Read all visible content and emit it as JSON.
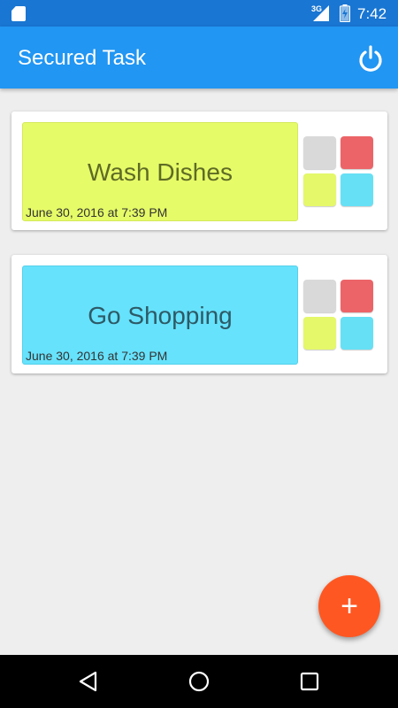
{
  "status_bar": {
    "network": "3G",
    "time": "7:42",
    "icons": [
      "sd-card-icon",
      "signal-icon",
      "battery-icon"
    ]
  },
  "app_bar": {
    "title": "Secured Task",
    "action_icon": "power-icon"
  },
  "tasks": [
    {
      "title": "Wash Dishes",
      "date": "June 30, 2016 at 7:39 PM",
      "color": "#e6fb68"
    },
    {
      "title": "Go Shopping",
      "date": "June 30, 2016 at 7:39 PM",
      "color": "#66e2fc"
    }
  ],
  "color_swatches": [
    {
      "name": "gray",
      "color": "#d9d9d9"
    },
    {
      "name": "red",
      "color": "#ec6468"
    },
    {
      "name": "lime",
      "color": "#e4f86a"
    },
    {
      "name": "cyan",
      "color": "#66e0f5"
    }
  ],
  "fab": {
    "icon": "plus-icon",
    "glyph": "+",
    "color": "#ff5722"
  },
  "nav_bar": {
    "icons": [
      "back-icon",
      "home-icon",
      "recents-icon"
    ]
  },
  "colors": {
    "status_bar": "#1976d2",
    "app_bar": "#2196f3",
    "background": "#eeeeee"
  }
}
